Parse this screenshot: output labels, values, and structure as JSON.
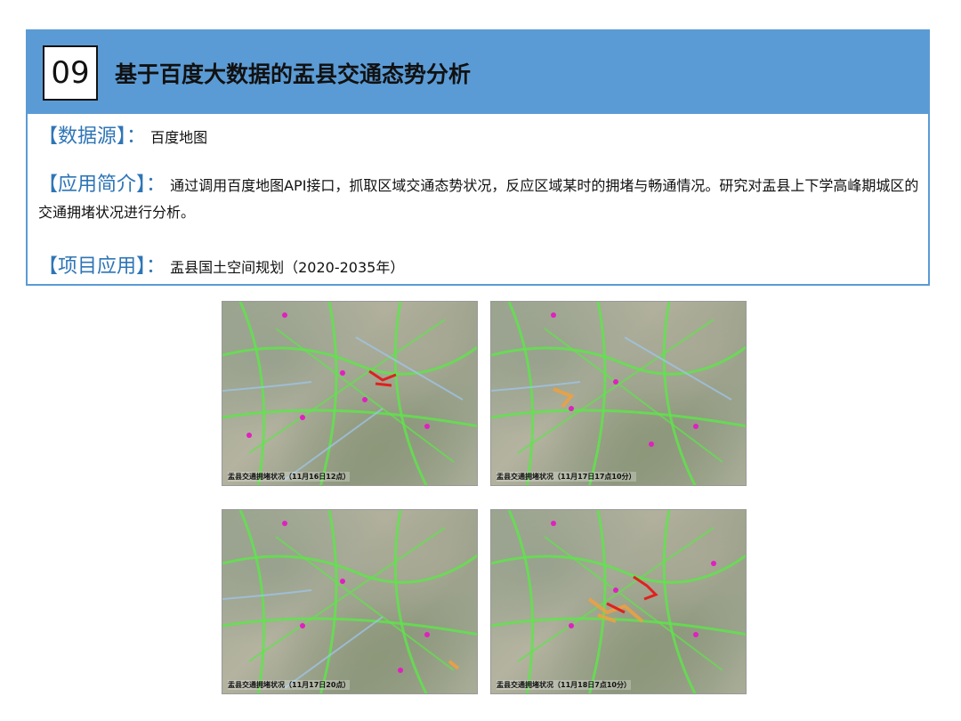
{
  "section": {
    "number": "09",
    "title": "基于百度大数据的盂县交通态势分析"
  },
  "info": {
    "source_label": "【数据源】：",
    "source_value": "百度地图",
    "intro_label": "【应用简介】：",
    "intro_value": "通过调用百度地图API接口，抓取区域交通态势状况，反应区域某时的拥堵与畅通情况。研究对盂县上下学高峰期城区的交通拥堵状况进行分析。",
    "project_label": "【项目应用】：",
    "project_value": "盂县国土空间规划（2020-2035年）"
  },
  "maps": [
    {
      "caption": "盂县交通拥堵状况（11月16日12点）"
    },
    {
      "caption": "盂县交通拥堵状况（11月17日17点10分）"
    },
    {
      "caption": "盂县交通拥堵状况（11月17日20点）"
    },
    {
      "caption": "盂县交通拥堵状况（11月18日7点10分）"
    }
  ],
  "colors": {
    "accent": "#5b9bd5",
    "label_blue": "#2e75b6",
    "road_clear": "#5ee64a",
    "road_slow": "#f0a040",
    "road_jam": "#e02020",
    "poi_marker": "#e020c0"
  }
}
